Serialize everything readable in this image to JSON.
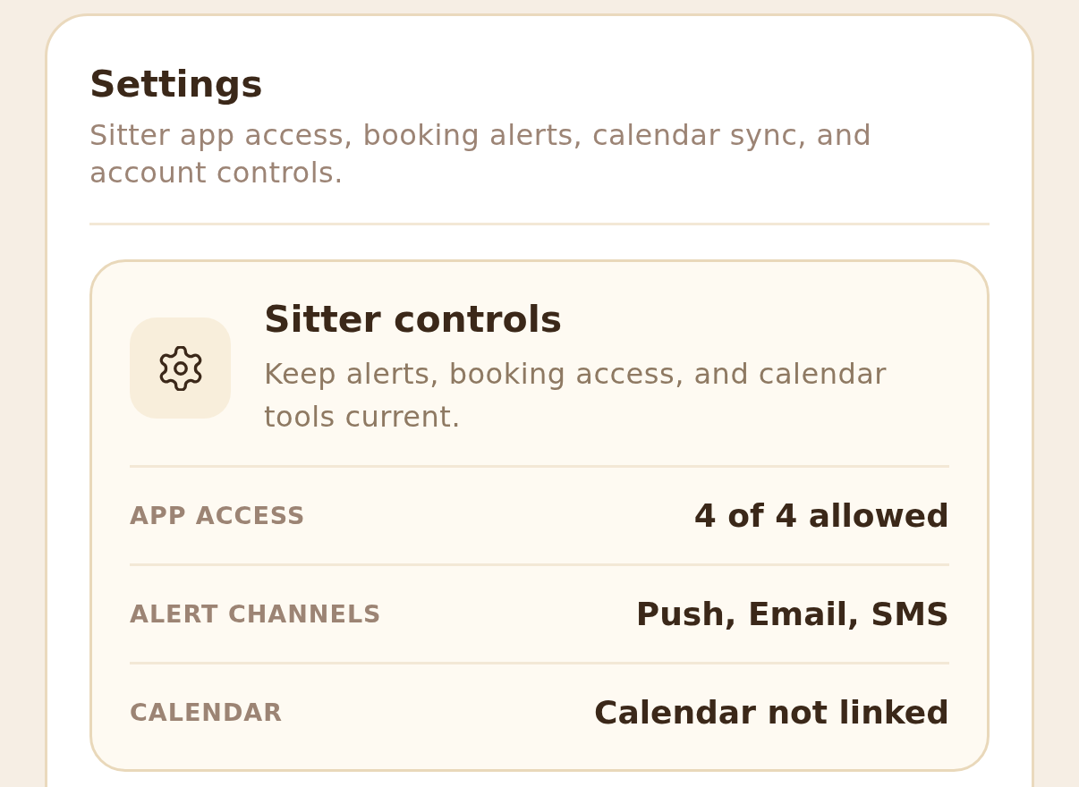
{
  "page": {
    "title": "Settings",
    "subtitle": "Sitter app access, booking alerts, calendar sync, and account controls."
  },
  "panel": {
    "title": "Sitter controls",
    "description": "Keep alerts, booking access, and calendar tools current.",
    "rows": [
      {
        "label": "APP ACCESS",
        "value": "4 of 4 allowed"
      },
      {
        "label": "ALERT CHANNELS",
        "value": "Push, Email, SMS"
      },
      {
        "label": "CALENDAR",
        "value": "Calendar not linked"
      }
    ]
  }
}
